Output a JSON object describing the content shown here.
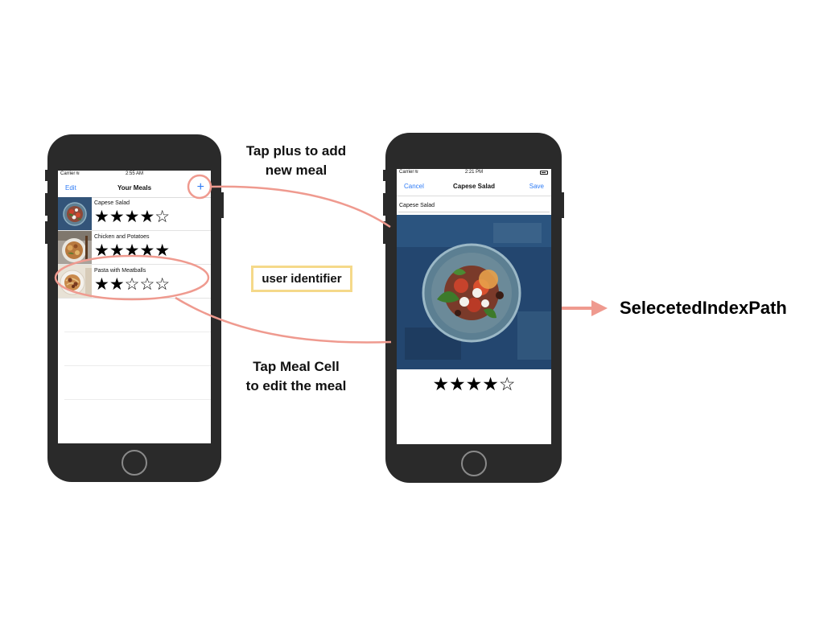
{
  "left_phone": {
    "status": {
      "carrier": "Carrier",
      "time": "2:55 AM"
    },
    "navbar": {
      "edit_label": "Edit",
      "title": "Your Meals",
      "add_symbol": "+"
    },
    "meals": [
      {
        "name": "Capese Salad",
        "stars": "★★★★☆",
        "rating": 4
      },
      {
        "name": "Chicken and Potatoes",
        "stars": "★★★★★",
        "rating": 5
      },
      {
        "name": "Pasta with Meatballs",
        "stars": "★★☆☆☆",
        "rating": 2
      }
    ]
  },
  "right_phone": {
    "status": {
      "carrier": "Carrier",
      "time": "2:21 PM"
    },
    "navbar": {
      "cancel_label": "Cancel",
      "title": "Capese Salad",
      "save_label": "Save"
    },
    "name_field_value": "Capese Salad",
    "stars": "★★★★☆",
    "rating": 4
  },
  "annotations": {
    "tap_plus": [
      "Tap plus to add",
      "new meal"
    ],
    "user_identifier": "user identifier",
    "tap_cell": [
      "Tap Meal Cell",
      "to edit the meal"
    ],
    "result": "SelecetedIndexPath"
  },
  "colors": {
    "annotation_stroke": "#ef9a8f",
    "identifier_border": "#f5d98a",
    "ios_blue": "#2f7cf6",
    "phone_body": "#2a2a2a"
  }
}
